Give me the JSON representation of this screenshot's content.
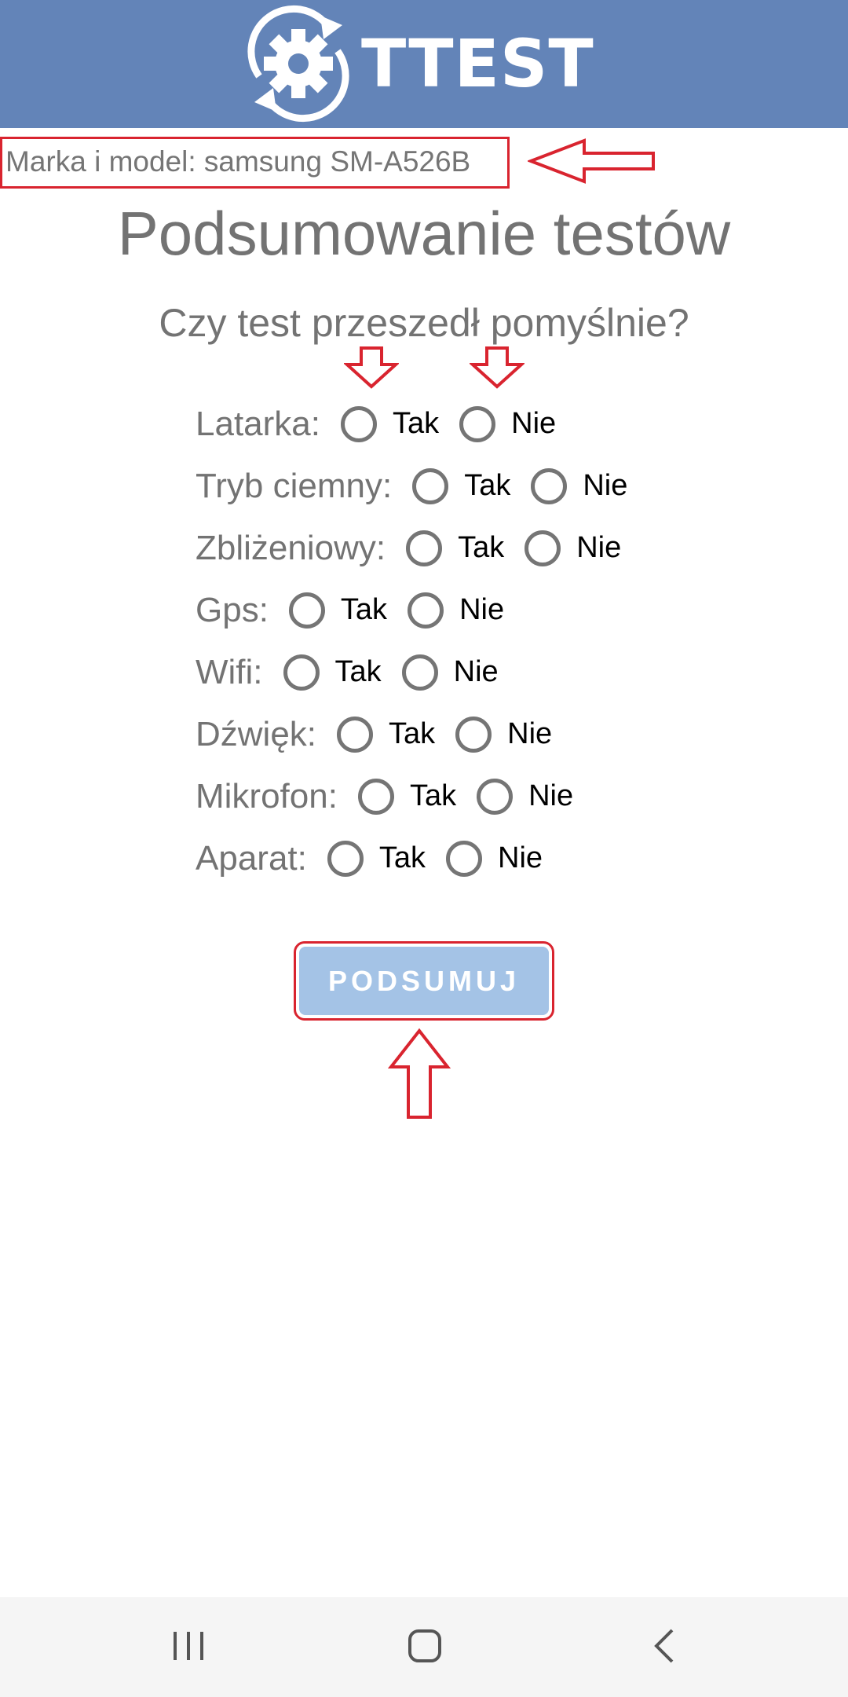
{
  "header": {
    "logo_text": "TTEST"
  },
  "device": {
    "model_label": "Marka i model: samsung SM-A526B"
  },
  "page": {
    "title": "Podsumowanie testów",
    "question": "Czy test przeszedł pomyślnie?"
  },
  "tests": [
    {
      "label": "Latarka:",
      "yes": "Tak",
      "no": "Nie"
    },
    {
      "label": "Tryb ciemny:",
      "yes": "Tak",
      "no": "Nie"
    },
    {
      "label": "Zbliżeniowy:",
      "yes": "Tak",
      "no": "Nie"
    },
    {
      "label": "Gps:",
      "yes": "Tak",
      "no": "Nie"
    },
    {
      "label": "Wifi:",
      "yes": "Tak",
      "no": "Nie"
    },
    {
      "label": "Dźwięk:",
      "yes": "Tak",
      "no": "Nie"
    },
    {
      "label": "Mikrofon:",
      "yes": "Tak",
      "no": "Nie"
    },
    {
      "label": "Aparat:",
      "yes": "Tak",
      "no": "Nie"
    }
  ],
  "actions": {
    "summarize_label": "PODSUMUJ"
  },
  "navbar": {
    "icons": [
      "recent-apps-icon",
      "home-icon",
      "back-icon"
    ]
  },
  "colors": {
    "header_bg": "#6384b8",
    "button_bg": "#a4c3e6",
    "annotation": "#d9242f",
    "text_gray": "#737373"
  }
}
